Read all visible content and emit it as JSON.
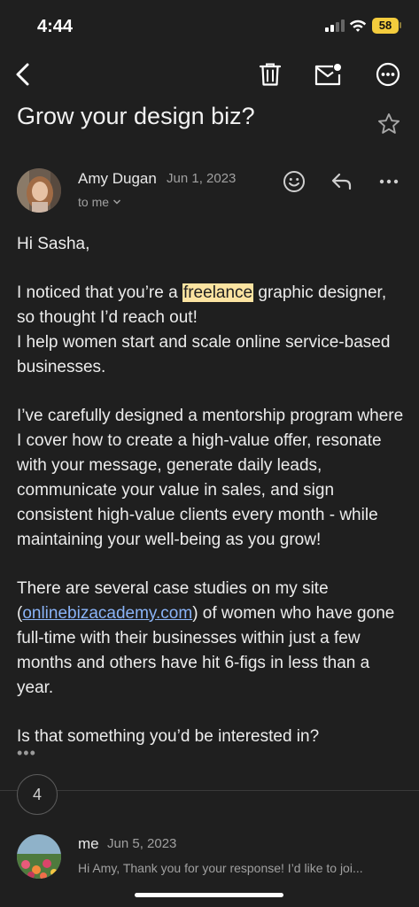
{
  "status_bar": {
    "time": "4:44",
    "battery_level": "58",
    "battery_color": "#f4cc3d"
  },
  "toolbar": {
    "back_icon": "chevron-left-icon",
    "delete_icon": "trash-icon",
    "mark_unread_icon": "mail-unread-icon",
    "more_icon": "more-circle-icon"
  },
  "email": {
    "subject": "Grow your design biz?",
    "sender": {
      "name": "Amy Dugan",
      "date": "Jun 1, 2023",
      "recipient": "to me"
    },
    "body": {
      "greeting": "Hi Sasha,",
      "p2_before": "I noticed that you’re a ",
      "p2_highlight": "freelance",
      "p2_after": " graphic designer, so thought I’d reach out!",
      "p2_line2": "I help women start and scale online service-based businesses.",
      "p3": "I’ve carefully designed a mentorship program where I cover how to create a high-value offer, resonate with your message, generate daily leads, communicate your value in sales, and sign consistent high-value clients every month - while maintaining your well-being as you grow!",
      "p4_before": "There are several case studies on my site (",
      "p4_link": "onlinebizacademy.com",
      "p4_after": ") of women who have gone full-time with their businesses within just a few months and others have hit 6-figs in less than a year.",
      "p5": "Is that something you’d be interested in?"
    },
    "quoted_text_toggle": "•••"
  },
  "thread": {
    "collapsed_count": "4",
    "reply": {
      "name": "me",
      "date": "Jun 5, 2023",
      "snippet": "Hi Amy, Thank you for your response! I’d like to joi..."
    }
  },
  "colors": {
    "background": "#1f1f1f",
    "highlight": "#fbe3a1",
    "link": "#8ab4f8"
  }
}
